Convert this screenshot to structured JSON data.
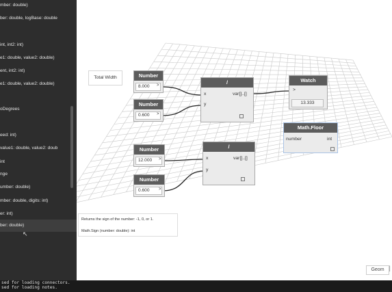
{
  "library": {
    "items": [
      "mber: double)",
      "ber: double, logBase: double",
      "int, int2: int)",
      "e1: double, value2: double)",
      "ent, int2: int)",
      "e1: double, value2: double)",
      "oDegrees",
      "eed: int)",
      "value1: double, value2: doub",
      "int",
      "nge",
      "umber: double)",
      "mber: double, digits: int)",
      "er: int)",
      "ber: double)"
    ]
  },
  "canvas": {
    "note": "Total Width",
    "nodes": {
      "number1": {
        "title": "Number",
        "value": "8.000"
      },
      "number2": {
        "title": "Number",
        "value": "0.600"
      },
      "number3": {
        "title": "Number",
        "value": "12.000"
      },
      "number4": {
        "title": "Number",
        "value": "0.600"
      },
      "divide1": {
        "title": "/",
        "in_x": "x",
        "in_y": "y",
        "out": "var[]..[]"
      },
      "divide2": {
        "title": "/",
        "in_x": "x",
        "in_y": "y",
        "out": "var[]..[]"
      },
      "watch": {
        "title": "Watch",
        "value": "13.333"
      },
      "floor": {
        "title": "Math.Floor",
        "input": "number",
        "output": "int"
      }
    }
  },
  "tooltip": {
    "description": "Returns the sign of the number: -1, 0, or 1.",
    "signature": "Math.Sign (number: double): int"
  },
  "view_buttons": {
    "geom": "Geom"
  },
  "console": {
    "lines": [
      "sed for loading connectors.",
      "sed for loading notes."
    ]
  },
  "colors": {
    "sidebar_bg": "#2d2d2d",
    "node_header": "#5c5c5c",
    "selected_node_border": "#a9c3e6",
    "grid_line": "#c8c8c8"
  }
}
